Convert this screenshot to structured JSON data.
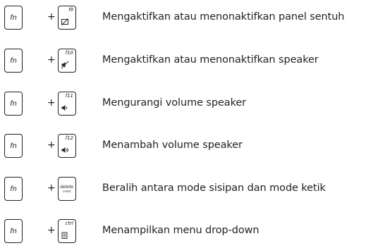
{
  "rows": [
    {
      "fn": "fn",
      "plus": "+",
      "key": "f9",
      "icon": "touchpad-off-icon",
      "description": "Mengaktifkan atau menonaktifkan panel sentuh"
    },
    {
      "fn": "fn",
      "plus": "+",
      "key": "f10",
      "icon": "speaker-mute-icon",
      "description": "Mengaktifkan atau menonaktifkan speaker"
    },
    {
      "fn": "fn",
      "plus": "+",
      "key": "f11",
      "icon": "volume-down-icon",
      "description": "Mengurangi volume speaker"
    },
    {
      "fn": "fn",
      "plus": "+",
      "key": "f12",
      "icon": "volume-up-icon",
      "description": "Menambah volume speaker"
    },
    {
      "fn": "fn",
      "plus": "+",
      "key": "delete",
      "key_sub": "insert",
      "icon": "",
      "description": "Beralih antara mode sisipan dan mode ketik"
    },
    {
      "fn": "fn",
      "plus": "+",
      "key": "ctrl",
      "icon": "menu-icon",
      "description": "Menampilkan menu drop-down"
    }
  ]
}
